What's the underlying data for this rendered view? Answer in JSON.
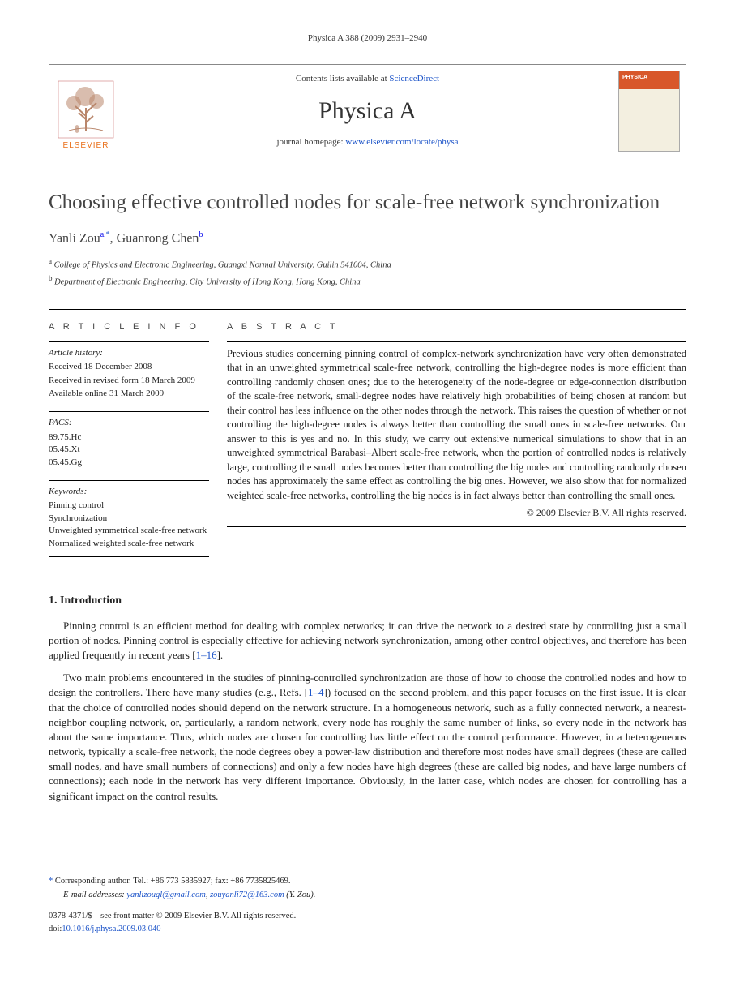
{
  "running_head": "Physica A 388 (2009) 2931–2940",
  "masthead": {
    "contents_prefix": "Contents lists available at ",
    "contents_link": "ScienceDirect",
    "journal_title": "Physica A",
    "homepage_prefix": "journal homepage: ",
    "homepage_link": "www.elsevier.com/locate/physa",
    "publisher_label": "ELSEVIER",
    "cover_badge": "PHYSICA"
  },
  "title": "Choosing effective controlled nodes for scale-free network synchronization",
  "authors_html_parts": {
    "a1_name": "Yanli Zou",
    "a1_marks": "a,",
    "a1_corr": "*",
    "sep": ", ",
    "a2_name": "Guanrong Chen",
    "a2_marks": "b"
  },
  "affiliations": [
    "College of Physics and Electronic Engineering, Guangxi Normal University, Guilin 541004, China",
    "Department of Electronic Engineering, City University of Hong Kong, Hong Kong, China"
  ],
  "aff_marks": [
    "a",
    "b"
  ],
  "section_heads": {
    "info": "A R T I C L E   I N F O",
    "abstract": "A B S T R A C T"
  },
  "history": {
    "label": "Article history:",
    "lines": [
      "Received 18 December 2008",
      "Received in revised form 18 March 2009",
      "Available online 31 March 2009"
    ]
  },
  "pacs": {
    "label": "PACS:",
    "items": [
      "89.75.Hc",
      "05.45.Xt",
      "05.45.Gg"
    ]
  },
  "keywords": {
    "label": "Keywords:",
    "items": [
      "Pinning control",
      "Synchronization",
      "Unweighted symmetrical scale-free network",
      "Normalized weighted scale-free network"
    ]
  },
  "abstract_text": "Previous studies concerning pinning control of complex-network synchronization have very often demonstrated that in an unweighted symmetrical scale-free network, controlling the high-degree nodes is more efficient than controlling randomly chosen ones; due to the heterogeneity of the node-degree or edge-connection distribution of the scale-free network, small-degree nodes have relatively high probabilities of being chosen at random but their control has less influence on the other nodes through the network. This raises the question of whether or not controlling the high-degree nodes is always better than controlling the small ones in scale-free networks. Our answer to this is yes and no. In this study, we carry out extensive numerical simulations to show that in an unweighted symmetrical Barabasi–Albert scale-free network, when the portion of controlled nodes is relatively large, controlling the small nodes becomes better than controlling the big nodes and controlling randomly chosen nodes has approximately the same effect as controlling the big ones. However, we also show that for normalized weighted scale-free networks, controlling the big nodes is in fact always better than controlling the small ones.",
  "copyright": "© 2009 Elsevier B.V. All rights reserved.",
  "intro": {
    "heading": "1. Introduction",
    "p1_a": "Pinning control is an efficient method for dealing with complex networks; it can drive the network to a desired state by controlling just a small portion of nodes. Pinning control is especially effective for achieving network synchronization, among other control objectives, and therefore has been applied frequently in recent years [",
    "p1_ref": "1–16",
    "p1_b": "].",
    "p2_a": "Two main problems encountered in the studies of pinning-controlled synchronization are those of how to choose the controlled nodes and how to design the controllers. There have many studies (e.g., Refs. [",
    "p2_ref": "1–4",
    "p2_b": "]) focused on the second problem, and this paper focuses on the first issue. It is clear that the choice of controlled nodes should depend on the network structure. In a homogeneous network, such as a fully connected network, a nearest-neighbor coupling network, or, particularly, a random network, every node has roughly the same number of links, so every node in the network has about the same importance. Thus, which nodes are chosen for controlling has little effect on the control performance. However, in a heterogeneous network, typically a scale-free network, the node degrees obey a power-law distribution and therefore most nodes have small degrees (these are called small nodes, and have small numbers of connections) and only a few nodes have high degrees (these are called big nodes, and have large numbers of connections); each node in the network has very different importance. Obviously, in the latter case, which nodes are chosen for controlling has a significant impact on the control results."
  },
  "footer": {
    "corr_prefix": "Corresponding author. Tel.: +86 773 5835927; fax: +86 7735825469.",
    "emails_label": "E-mail addresses:",
    "email1": "yanlizougl@gmail.com",
    "email_sep": ", ",
    "email2": "zouyanli72@163.com",
    "email_tail": " (Y. Zou).",
    "issn_line": "0378-4371/$ – see front matter © 2009 Elsevier B.V. All rights reserved.",
    "doi_label": "doi:",
    "doi": "10.1016/j.physa.2009.03.040"
  }
}
